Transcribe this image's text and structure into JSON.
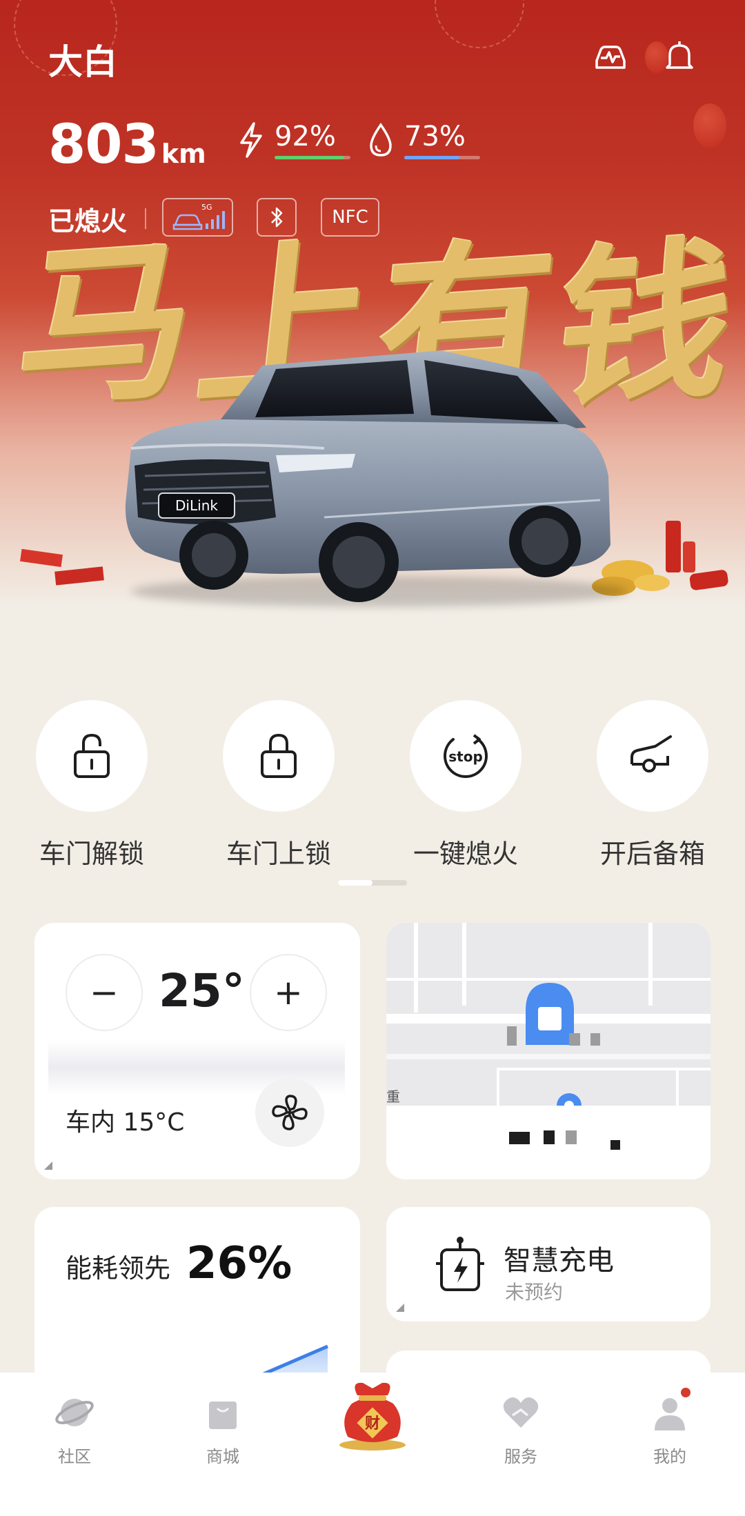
{
  "header": {
    "car_name": "大白",
    "range_value": "803",
    "range_unit": "km",
    "battery_percent": "92%",
    "battery_level": 0.92,
    "fuel_percent": "73%",
    "fuel_level": 0.73,
    "engine_status": "已熄火",
    "network_badge": "5G",
    "nfc_badge": "NFC",
    "icons": [
      "car-diagnostic-icon",
      "bell-icon",
      "lightning-icon",
      "droplet-icon",
      "bluetooth-icon",
      "signal-icon"
    ]
  },
  "banner": {
    "calligraphy": [
      "马",
      "上",
      "有",
      "钱"
    ],
    "plate_text": "DiLink"
  },
  "quick_actions": [
    {
      "label": "车门解锁",
      "icon": "unlock-icon"
    },
    {
      "label": "车门上锁",
      "icon": "lock-icon"
    },
    {
      "label": "一键熄火",
      "icon": "stop-icon",
      "icon_text": "stop"
    },
    {
      "label": "开后备箱",
      "icon": "trunk-icon"
    }
  ],
  "climate": {
    "minus": "−",
    "plus": "+",
    "target_temp": "25°",
    "inside_temp": "车内 15°C"
  },
  "map_card": {
    "partial_label": "重"
  },
  "energy": {
    "title": "能耗领先",
    "value": "26%"
  },
  "charging": {
    "title": "智慧充电",
    "subtitle": "未预约"
  },
  "bottom_nav": [
    {
      "label": "社区",
      "icon": "planet-icon"
    },
    {
      "label": "商城",
      "icon": "shopping-bag-icon"
    },
    {
      "label": "",
      "icon": "fortune-bag-icon",
      "badge_text": "财"
    },
    {
      "label": "服务",
      "icon": "heart-hand-icon"
    },
    {
      "label": "我的",
      "icon": "profile-icon"
    }
  ],
  "colors": {
    "hero_red": "#b8261d",
    "battery_bar": "#5fd16d",
    "fuel_bar": "#6fa5ff",
    "accent_blue": "#3d7fe6",
    "gold": "#e4bd6a"
  }
}
